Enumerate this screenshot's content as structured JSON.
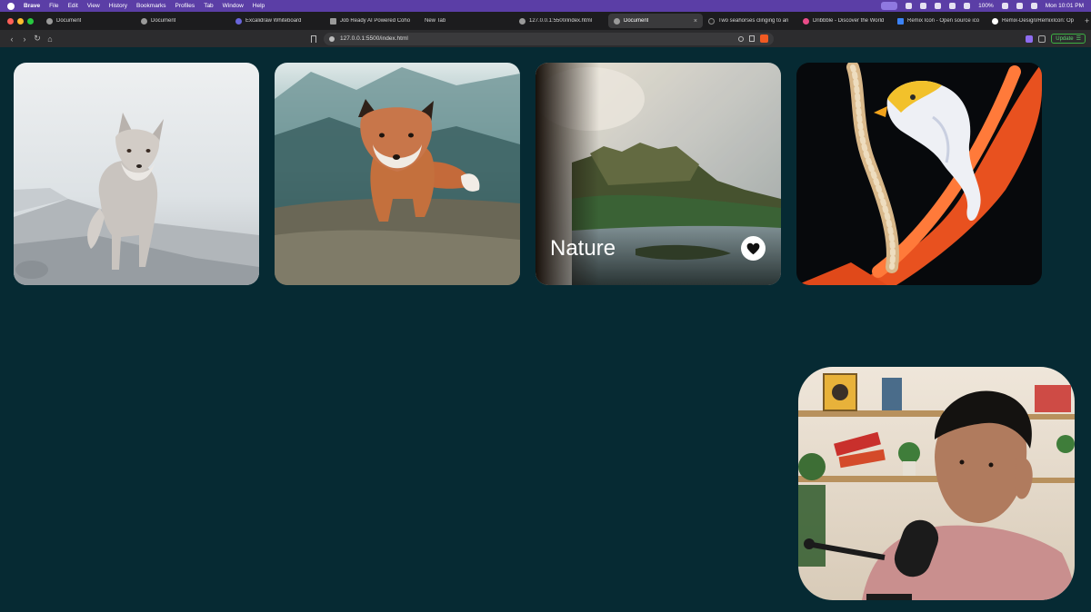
{
  "menubar": {
    "app_name": "Brave",
    "items": [
      "File",
      "Edit",
      "View",
      "History",
      "Bookmarks",
      "Profiles",
      "Tab",
      "Window",
      "Help"
    ],
    "battery": "100%",
    "clock": "Mon 10:01 PM"
  },
  "tabs": [
    {
      "label": "Document",
      "active": false
    },
    {
      "label": "Document",
      "active": false
    },
    {
      "label": "Excalidraw Whiteboard",
      "active": false
    },
    {
      "label": "Job Ready AI Powered Coho",
      "active": false
    },
    {
      "label": "New Tab",
      "active": false
    },
    {
      "label": "127.0.0.1:5500/index.html",
      "active": false
    },
    {
      "label": "Document",
      "active": true
    },
    {
      "label": "Two seahorses clinging to an",
      "active": false
    },
    {
      "label": "Dribbble - Discover the World",
      "active": false
    },
    {
      "label": "Remix Icon - Open source ico",
      "active": false
    },
    {
      "label": "Remix-Design/RemixIcon: Op",
      "active": false
    }
  ],
  "tab_close_glyph": "×",
  "new_tab_glyph": "+",
  "nav": {
    "back": "‹",
    "forward": "›",
    "reload": "↻",
    "home": "⌂"
  },
  "address": {
    "url": "127.0.0.1:5500/index.html"
  },
  "update_button": {
    "label": "Update"
  },
  "cards": [
    {
      "subject": "arctic fox on rock",
      "title": ""
    },
    {
      "subject": "red fox on rocky ground",
      "title": ""
    },
    {
      "subject": "mountain landscape",
      "title": "Nature",
      "liked_icon": "heart-icon"
    },
    {
      "subject": "seahorses on coral",
      "title": ""
    }
  ],
  "colors": {
    "page_bg": "#062a33",
    "menubar": "#5b3ea6",
    "update_green": "#3cb043"
  }
}
